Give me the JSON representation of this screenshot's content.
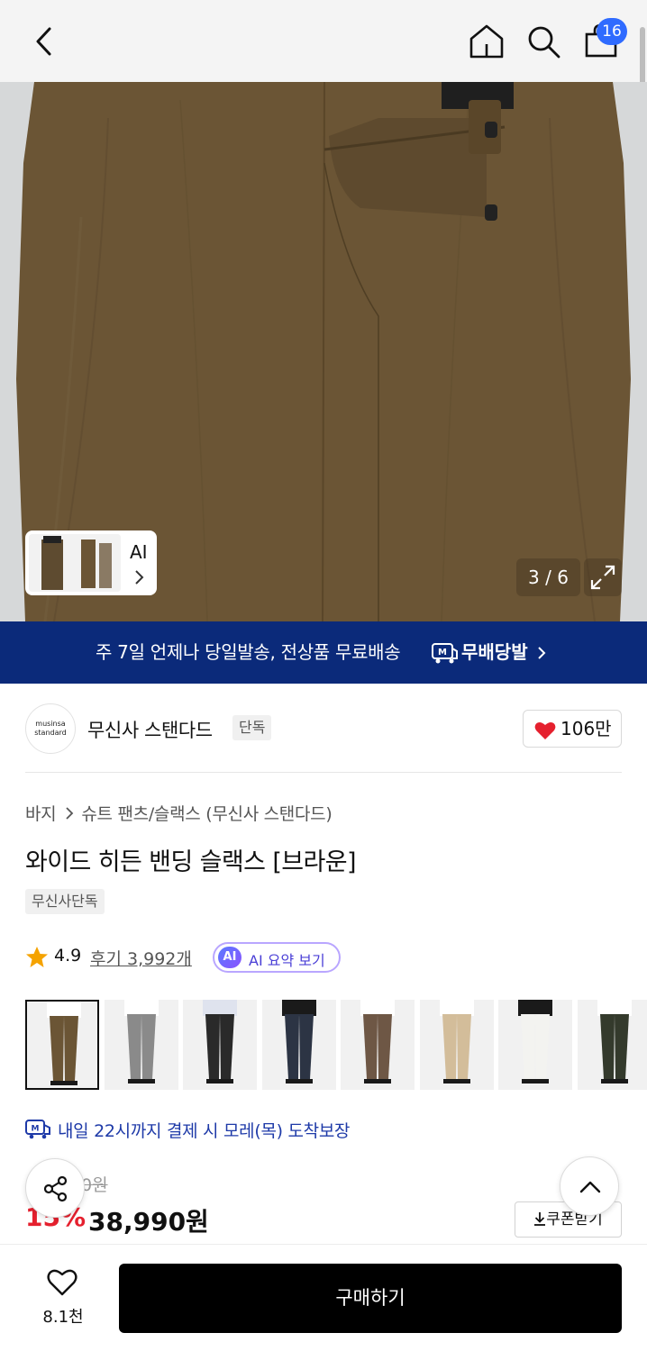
{
  "header": {
    "cart_count": "16",
    "icons": [
      "back-chevron-icon",
      "home-icon",
      "search-icon",
      "shopping-bag-icon"
    ]
  },
  "gallery": {
    "ai_label": "AI",
    "counter": "3 / 6",
    "fabric_color": "#6b5535"
  },
  "banner": {
    "text": "주 7일 언제나 당일발송, 전상품 무료배송",
    "brand": "무배당발",
    "background": "#0b2a7a"
  },
  "brand": {
    "logo_line1": "musinsa",
    "logo_line2": "standard",
    "name": "무신사 스탠다드",
    "tag": "단독",
    "likes": "106만"
  },
  "product": {
    "breadcrumb": [
      "바지",
      "슈트 팬츠/슬랙스 (무신사 스탠다드)"
    ],
    "title": "와이드 히든 밴딩 슬랙스 [브라운]",
    "exclusive_tag": "무신사단독",
    "rating": "4.9",
    "reviews": "후기 3,992개",
    "ai_badge": "AI",
    "ai_summary": "AI 요약 보기",
    "color_options": [
      {
        "name": "브라운",
        "color": "#6b5535",
        "shirt": "#ffffff"
      },
      {
        "name": "그레이",
        "color": "#8a8a8a",
        "shirt": "#ffffff"
      },
      {
        "name": "블랙",
        "color": "#2a2a2a",
        "shirt": "#dfe3ee"
      },
      {
        "name": "네이비",
        "color": "#2c3444",
        "shirt": "#1a1a1a"
      },
      {
        "name": "브라운",
        "color": "#6e5745",
        "shirt": "#ffffff"
      },
      {
        "name": "베이지",
        "color": "#d3bd9a",
        "shirt": "#ffffff"
      },
      {
        "name": "화이트",
        "color": "#f3f3f0",
        "shirt": "#1a1a1a"
      },
      {
        "name": "카키",
        "color": "#343a2c",
        "shirt": "#ffffff"
      }
    ],
    "delivery_note": "내일 22시까지 결제 시 모레(목) 도착보장",
    "original_price": "0원",
    "discount": "15%",
    "sale_price": "38,990원",
    "coupon": "쿠폰받기"
  },
  "bottom": {
    "wish_count": "8.1천",
    "buy_label": "구매하기"
  }
}
